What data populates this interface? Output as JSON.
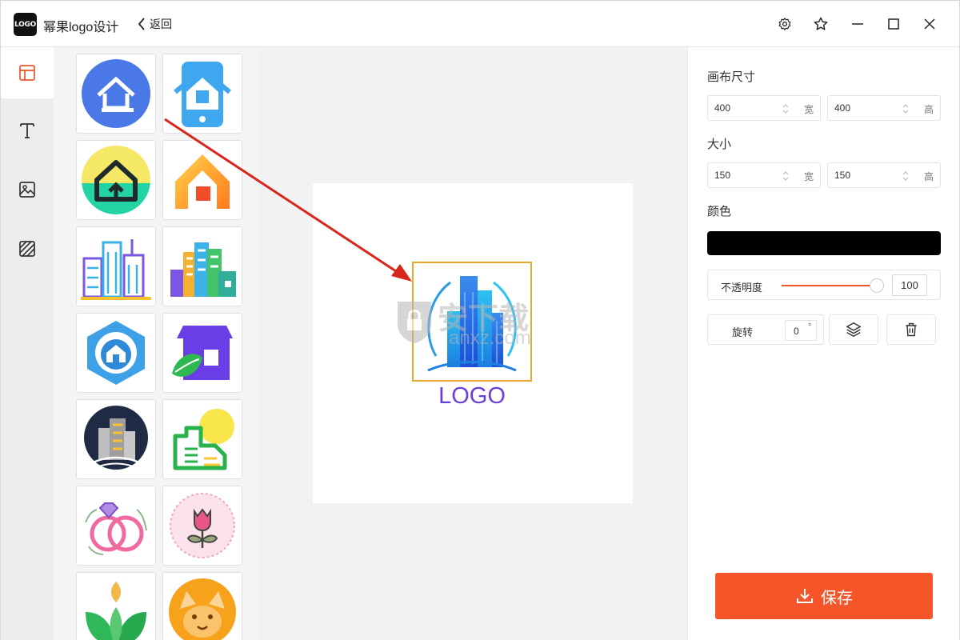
{
  "app": {
    "logo_text": "LOGO",
    "title": "幂果logo设计",
    "back_label": "返回"
  },
  "window_controls": [
    "gear-icon",
    "star-icon",
    "minimize-icon",
    "maximize-icon",
    "close-icon"
  ],
  "rail": {
    "items": [
      {
        "icon": "template-icon",
        "active": true
      },
      {
        "icon": "text-icon",
        "active": false
      },
      {
        "icon": "image-icon",
        "active": false
      },
      {
        "icon": "texture-icon",
        "active": false
      }
    ]
  },
  "templates": [
    "house-circle-blue",
    "house-phone-blue",
    "house-circle-yellow-green",
    "house-orange-gradient",
    "city-buildings-purple",
    "city-buildings-colorful",
    "house-hexagon-blue",
    "house-shop-purple-leaf",
    "buildings-dark-circle",
    "building-green-sun",
    "rings-diamond-pink",
    "rose-badge-pink",
    "leaf-plant-green",
    "fox-orange-circle"
  ],
  "canvas": {
    "logo_text": "LOGO",
    "watermark_text": "安下载",
    "watermark_sub": "anxz.com"
  },
  "panel": {
    "canvas_size_label": "画布尺寸",
    "canvas_width": "400",
    "canvas_height": "400",
    "size_label": "大小",
    "size_width": "150",
    "size_height": "150",
    "width_unit": "宽",
    "height_unit": "高",
    "color_label": "颜色",
    "color_value": "#000000",
    "opacity_label": "不透明度",
    "opacity_value": "100",
    "rotate_label": "旋转",
    "rotate_value": "0",
    "rotate_unit": "°",
    "save_label": "保存"
  },
  "colors": {
    "accent": "#f6552a",
    "selection": "#e6a92c",
    "logo_text": "#6a3fd6",
    "annotation_arrow": "#d9261c"
  }
}
